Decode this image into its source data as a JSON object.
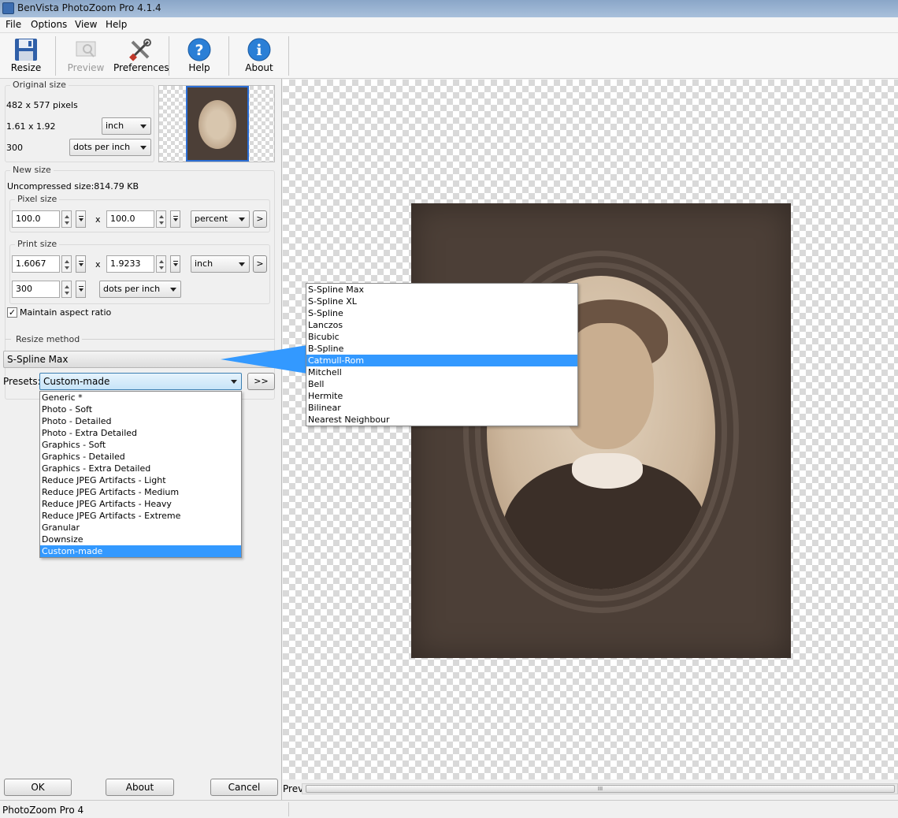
{
  "window": {
    "title": "BenVista PhotoZoom Pro 4.1.4"
  },
  "menu": [
    "File",
    "Options",
    "View",
    "Help"
  ],
  "toolbar": {
    "resize": "Resize",
    "preview": "Preview",
    "preferences": "Preferences",
    "help": "Help",
    "about": "About"
  },
  "original_size": {
    "title": "Original size",
    "pixels": "482 x 577 pixels",
    "dimensions": "1.61 x 1.92",
    "unit": "inch",
    "resolution": "300",
    "resolution_unit": "dots per inch"
  },
  "new_size": {
    "title": "New size",
    "uncompressed": "Uncompressed size:814.79 KB",
    "pixel_size": {
      "title": "Pixel size",
      "width": "100.0",
      "height": "100.0",
      "x": "x",
      "unit": "percent",
      "more": ">"
    },
    "print_size": {
      "title": "Print size",
      "width": "1.6067",
      "height": "1.9233",
      "x": "x",
      "unit": "inch",
      "more": ">",
      "resolution": "300",
      "resolution_unit": "dots per inch"
    },
    "maintain_aspect": "Maintain aspect ratio",
    "maintain_checked": true
  },
  "resize_method": {
    "title": "Resize method",
    "selected": "S-Spline Max",
    "presets_label": "Presets:",
    "preset_selected": "Custom-made",
    "presets_more": ">>"
  },
  "method_list": {
    "items": [
      "S-Spline Max",
      "S-Spline XL",
      "S-Spline",
      "Lanczos",
      "Bicubic",
      "B-Spline",
      "Catmull-Rom",
      "Mitchell",
      "Bell",
      "Hermite",
      "Bilinear",
      "Nearest Neighbour"
    ],
    "selected_index": 6
  },
  "preset_list": {
    "items": [
      "Generic *",
      "Photo - Soft",
      "Photo - Detailed",
      "Photo - Extra Detailed",
      "Graphics - Soft",
      "Graphics - Detailed",
      "Graphics - Extra Detailed",
      "Reduce JPEG Artifacts - Light",
      "Reduce JPEG Artifacts - Medium",
      "Reduce JPEG Artifacts - Heavy",
      "Reduce JPEG Artifacts - Extreme",
      "Granular",
      "Downsize",
      "Custom-made"
    ],
    "selected_index": 13
  },
  "buttons": {
    "ok": "OK",
    "about": "About",
    "cancel": "Cancel"
  },
  "preview_label": "Previ",
  "scroll_grip": "III",
  "status": "PhotoZoom Pro 4",
  "colors": {
    "selection": "#3399ff",
    "callout_arrow": "#3399ff"
  }
}
